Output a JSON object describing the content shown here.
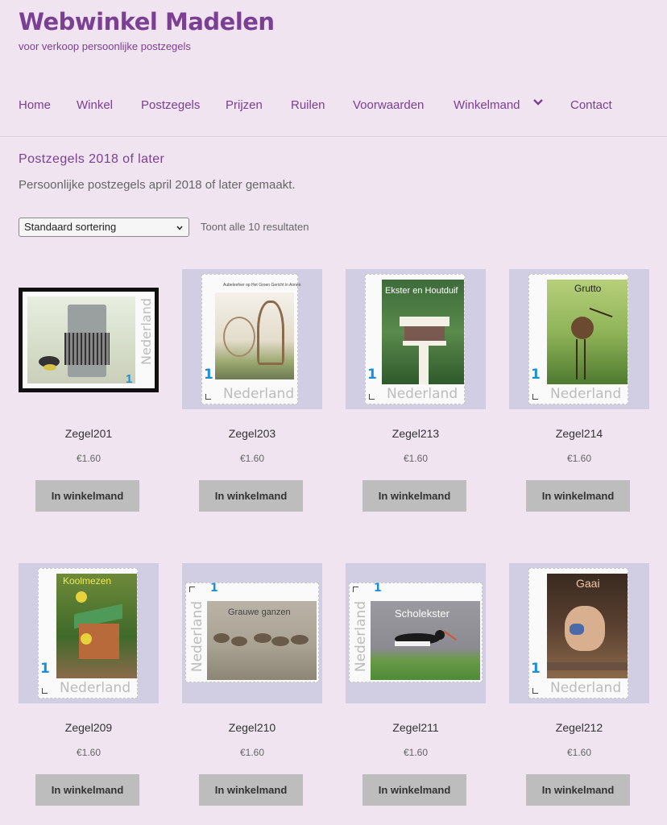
{
  "header": {
    "site_title": "Webwinkel Madelen",
    "tagline": "voor verkoop persoonlijke postzegels"
  },
  "nav": {
    "items": [
      {
        "label": "Home"
      },
      {
        "label": "Winkel"
      },
      {
        "label": "Postzegels"
      },
      {
        "label": "Prijzen"
      },
      {
        "label": "Ruilen"
      },
      {
        "label": "Voorwaarden"
      },
      {
        "label": "Winkelmand",
        "icon": "chevron-down-icon"
      },
      {
        "label": "Contact"
      }
    ]
  },
  "page": {
    "title": "Postzegels 2018 of later",
    "description": "Persoonlijke postzegels april 2018 of later gemaakt."
  },
  "toolbar": {
    "sort_selected": "Standaard sortering",
    "result_count": "Toont alle 10 resultaten"
  },
  "stamp_text": {
    "country": "Nederland",
    "value": "1"
  },
  "products": [
    {
      "name": "Zegel201",
      "price": "€1.60",
      "button": "In winkelmand",
      "caption": ""
    },
    {
      "name": "Zegel203",
      "price": "€1.60",
      "button": "In winkelmand",
      "caption": "Aubeleefver op Het Groen Gericht in Annen"
    },
    {
      "name": "Zegel213",
      "price": "€1.60",
      "button": "In winkelmand",
      "caption": "Ekster en Houtduif"
    },
    {
      "name": "Zegel214",
      "price": "€1.60",
      "button": "In winkelmand",
      "caption": "Grutto"
    },
    {
      "name": "Zegel209",
      "price": "€1.60",
      "button": "In winkelmand",
      "caption": "Koolmezen"
    },
    {
      "name": "Zegel210",
      "price": "€1.60",
      "button": "In winkelmand",
      "caption": "Grauwe ganzen"
    },
    {
      "name": "Zegel211",
      "price": "€1.60",
      "button": "In winkelmand",
      "caption": "Scholekster"
    },
    {
      "name": "Zegel212",
      "price": "€1.60",
      "button": "In winkelmand",
      "caption": "Gaai"
    }
  ],
  "colors": {
    "background": "#f0e4f0",
    "brand_purple": "#7b3f93",
    "thumb_background": "#d1cde3",
    "button_grey": "#bdbdbd"
  }
}
